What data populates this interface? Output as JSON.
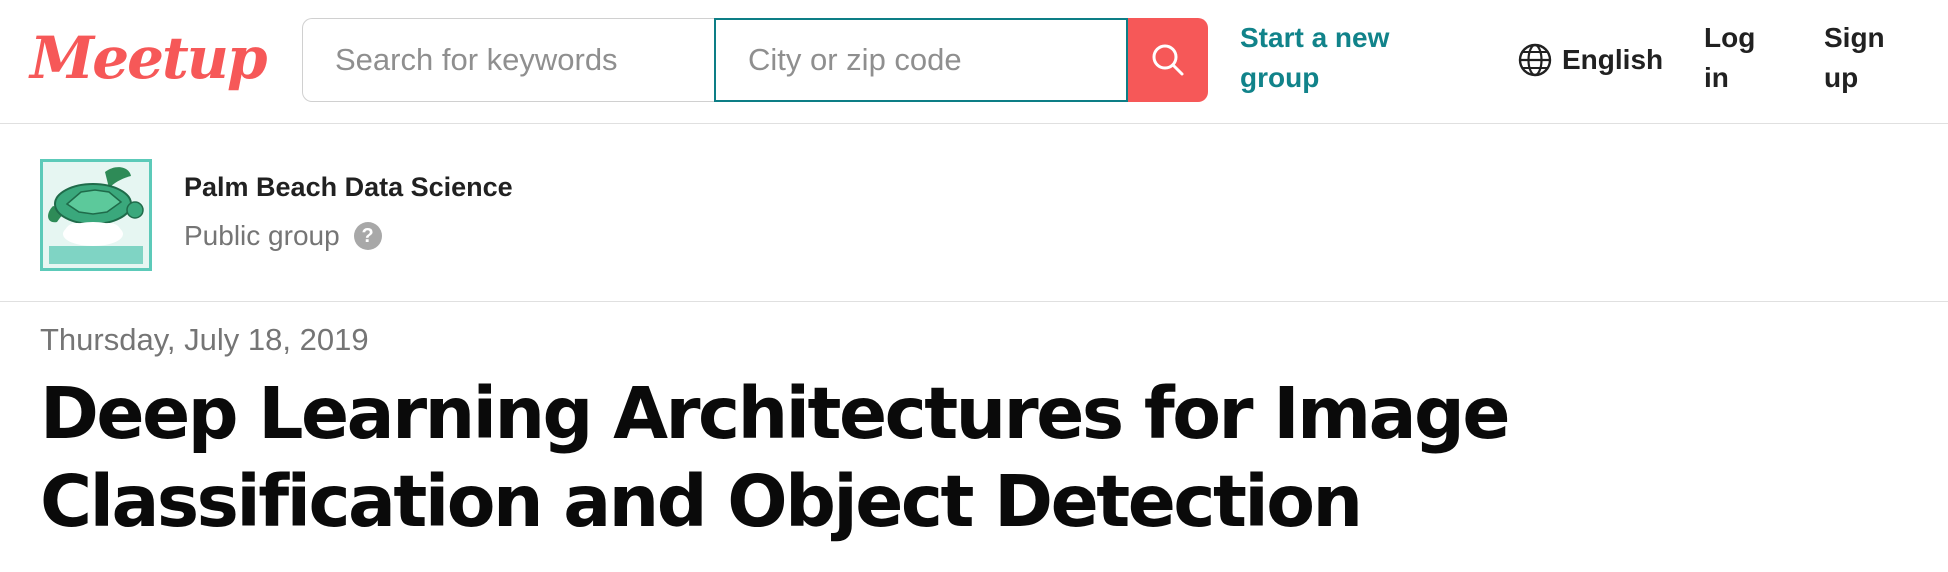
{
  "header": {
    "logo_text": "Meetup",
    "brand_color": "#f65858",
    "accent_color": "#11838a",
    "search": {
      "keyword_placeholder": "Search for keywords",
      "keyword_value": "",
      "location_placeholder": "City or zip code",
      "location_value": "",
      "button_icon": "search-icon"
    },
    "start_group_label": "Start a new group",
    "language_icon": "globe-icon",
    "language_label": "English",
    "login_label": "Log in",
    "signup_label": "Sign up"
  },
  "group": {
    "name": "Palm Beach Data Science",
    "type": "Public group",
    "help_icon": "question-icon",
    "logo_icon": "sea-turtle-logo"
  },
  "event": {
    "date": "Thursday, July 18, 2019",
    "title": "Deep Learning Architectures for Image Classification and Object Detection"
  }
}
